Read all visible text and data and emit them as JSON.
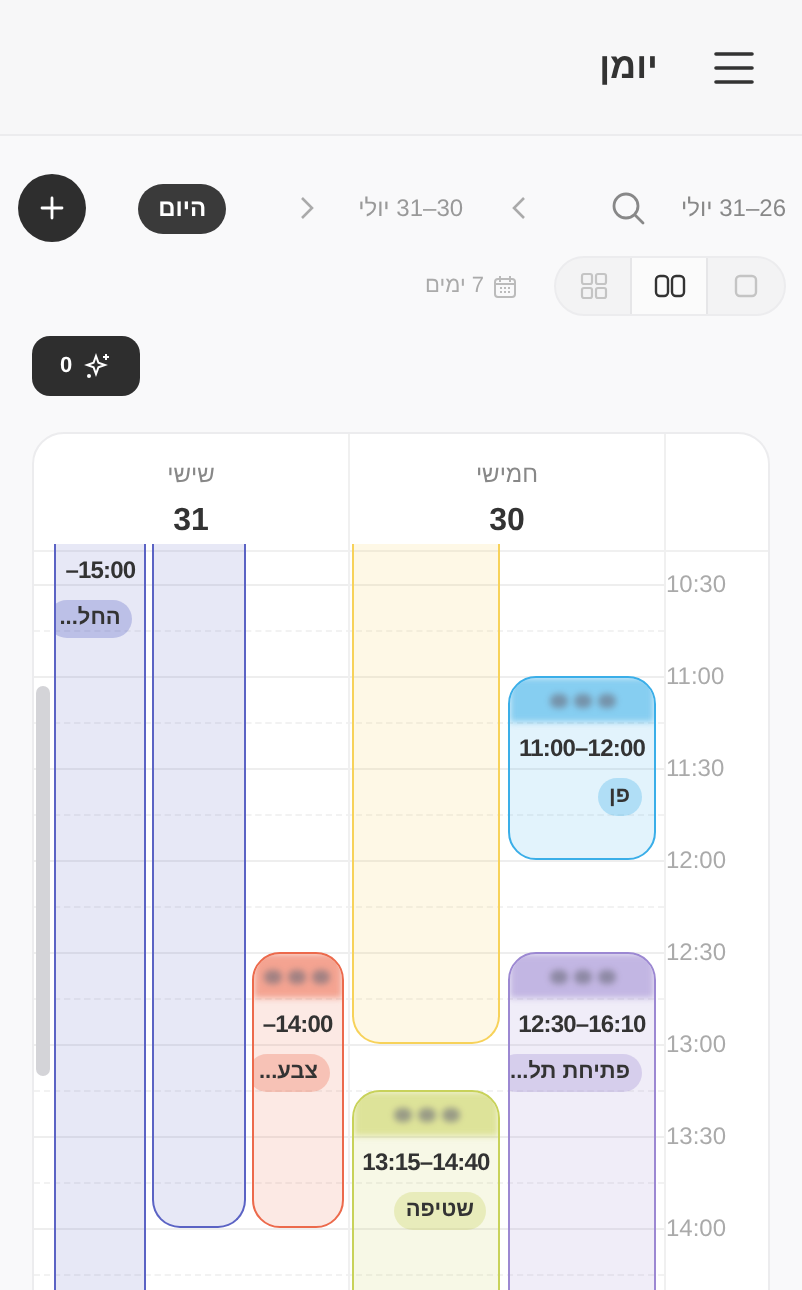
{
  "header": {
    "title": "יומן"
  },
  "toolbar": {
    "week_range": "26–31 יולי",
    "nav_range": "30–31 יולי",
    "today": "היום",
    "days_selector": "7 ימים",
    "views": [
      {
        "kind": "single",
        "selected": false
      },
      {
        "kind": "columns",
        "selected": true
      },
      {
        "kind": "grid",
        "selected": false
      }
    ],
    "sparkle_count": "0"
  },
  "times": [
    "10:30",
    "11:00",
    "11:30",
    "12:00",
    "12:30",
    "13:00",
    "13:30",
    "14:00"
  ],
  "days": [
    {
      "name": "חמישי",
      "date": "30",
      "lanes": [
        [
          {
            "time": "11:00–12:00",
            "tag": "פן",
            "color": "#3aaee8",
            "blurred_title": true
          },
          {
            "time": "12:30–16:10",
            "tag": "פתיחת תל...",
            "color": "#9c88d2",
            "blurred_title": true
          }
        ],
        [
          {
            "color": "#f7d25a",
            "blurred_title": false
          },
          {
            "time": "13:15–14:40",
            "tag": "שטיפה",
            "color": "#c8d25a",
            "blurred_title": true
          }
        ]
      ]
    },
    {
      "name": "שישי",
      "date": "31",
      "lanes": [
        [
          {
            "time": "–14:00",
            "tag": "צבע...",
            "color": "#ec6a4c",
            "blurred_title": true
          }
        ],
        [
          {
            "color": "#5b63c4",
            "blurred_title": false
          }
        ],
        [
          {
            "time": "–15:00",
            "tag": "החל...",
            "color": "#5b63c4",
            "blurred_title": false
          }
        ]
      ]
    }
  ]
}
